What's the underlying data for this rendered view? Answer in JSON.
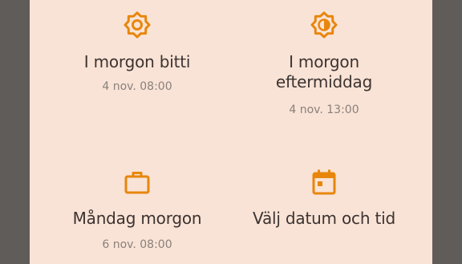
{
  "colors": {
    "accent": "#e8860c",
    "dialog_bg": "#f9e3d6",
    "scrim": "#5f5c5a",
    "title_text": "#3c3330",
    "secondary_text": "#8a807b"
  },
  "options": [
    {
      "icon": "sun-icon",
      "title": "I morgon bitti",
      "subtitle": "4 nov. 08:00"
    },
    {
      "icon": "sun-half-icon",
      "title": "I morgon eftermiddag",
      "subtitle": "4 nov. 13:00"
    },
    {
      "icon": "briefcase-icon",
      "title": "Måndag morgon",
      "subtitle": "6 nov. 08:00"
    },
    {
      "icon": "calendar-icon",
      "title": "Välj datum och tid",
      "subtitle": ""
    }
  ]
}
